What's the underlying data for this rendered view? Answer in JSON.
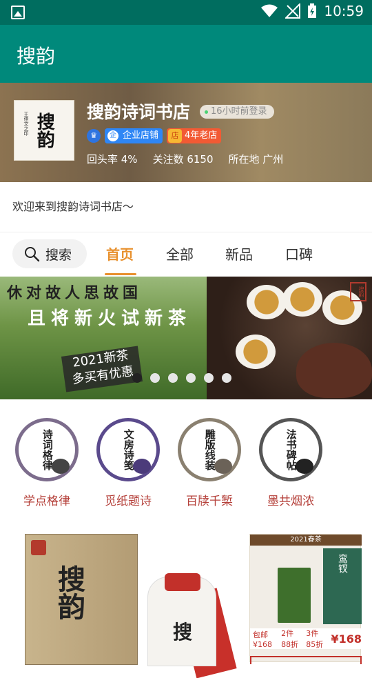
{
  "status_bar": {
    "time": "10:59"
  },
  "app_bar": {
    "title": "搜韵"
  },
  "shop": {
    "name": "搜韵诗词书店",
    "login_badge": "16小时前登录",
    "logo_text": "搜韵",
    "logo_small_text": "王佳文之印",
    "badges": {
      "enterprise": "企业店铺",
      "enterprise_icon": "企",
      "old_store": "4年老店",
      "old_store_icon": "店",
      "crown_icon": "crown-icon"
    },
    "stats": [
      "回头率 4%",
      "关注数 6150",
      "所在地 广州"
    ]
  },
  "welcome_text": "欢迎来到搜韵诗词书店～",
  "tabs": {
    "search_label": "搜索",
    "items": [
      "首页",
      "全部",
      "新品",
      "口碑"
    ],
    "active_index": 0
  },
  "banner": {
    "poem_line1": "休对故人思故国",
    "poem_line2": "且将新火试新茶",
    "promo_line1": "2021新茶",
    "promo_line2": "多买有优惠",
    "seal": "搜韵",
    "dot_count": 6,
    "active_dot": 0
  },
  "categories": [
    {
      "circle_text": "诗词格律",
      "label": "学点格律"
    },
    {
      "circle_text": "文房诗笺",
      "label": "觅纸题诗"
    },
    {
      "circle_text": "雕版线装",
      "label": "百牍千椠"
    },
    {
      "circle_text": "法书碑帖",
      "label": "墨共烟浓"
    }
  ],
  "products": {
    "box_text": "搜韵",
    "bottle_text": "搜",
    "tea_header": "2021春茶",
    "tea_bag_text": "鸾钗",
    "tea_price_tag": "包邮¥168",
    "tea_offer1": "2件88折",
    "tea_offer2": "3件85折",
    "tea_price": "¥168"
  },
  "colors": {
    "primary": "#00897b",
    "status_bar": "#006d5f",
    "accent": "#e8912e",
    "category_label": "#b5403a"
  }
}
